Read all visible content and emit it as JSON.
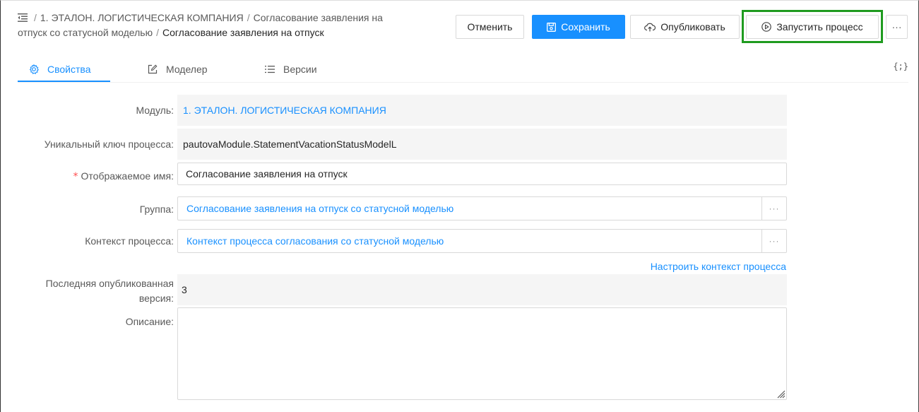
{
  "breadcrumb": {
    "module": "1. ЭТАЛОН. ЛОГИСТИЧЕСКАЯ КОМПАНИЯ",
    "group_line1": "Согласование заявления на",
    "group_line2": "отпуск со статусной моделью",
    "current": "Согласование заявления на отпуск",
    "separator": "/"
  },
  "toolbar": {
    "cancel_label": "Отменить",
    "save_label": "Сохранить",
    "publish_label": "Опубликовать",
    "run_label": "Запустить процесс",
    "more_label": "···"
  },
  "tabs": {
    "properties": "Свойства",
    "modeler": "Моделер",
    "versions": "Версии",
    "code": "{;}"
  },
  "form": {
    "module_label": "Модуль:",
    "module_value": "1. ЭТАЛОН. ЛОГИСТИЧЕСКАЯ КОМПАНИЯ",
    "key_label": "Уникальный ключ процесса:",
    "key_value": "pautovaModule.StatementVacationStatusModelL",
    "name_label": "Отображаемое имя:",
    "name_required_mark": "*",
    "name_value": "Согласование заявления на отпуск",
    "group_label": "Группа:",
    "group_value": "Согласование заявления на отпуск со статусной моделью",
    "context_label": "Контекст процесса:",
    "context_value": "Контекст процесса согласования со статусной моделью",
    "configure_context_link": "Настроить контекст процесса",
    "last_version_label_line1": "Последняя опубликованная",
    "last_version_label_line2": "версия:",
    "last_version_value": "3",
    "description_label": "Описание:",
    "description_value": "",
    "dots": "···"
  },
  "colors": {
    "accent": "#1890ff",
    "highlight": "#1f9b1f",
    "required": "#ff4d4f"
  },
  "icons": [
    "menu-fold-icon",
    "save-icon",
    "cloud-upload-icon",
    "play-circle-icon",
    "more-icon",
    "settings-icon",
    "edit-icon",
    "list-icon",
    "code-icon",
    "resize-handle-icon"
  ]
}
